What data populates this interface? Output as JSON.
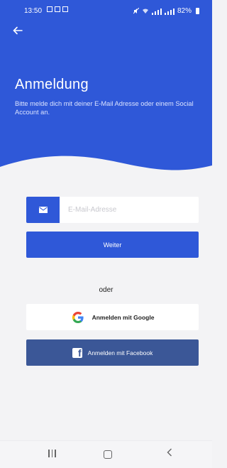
{
  "status_bar": {
    "time": "13:50",
    "battery": "82%",
    "left_icons": [
      "gallery-icon",
      "notification-icon",
      "notification-icon"
    ],
    "right_icons": [
      "mute-icon",
      "wifi-icon",
      "signal-icon",
      "signal-icon",
      "battery-icon"
    ]
  },
  "header": {
    "back_icon": "arrow-left-icon",
    "title": "Anmeldung",
    "subtitle": "Bitte melde dich mit deiner E-Mail Adresse oder einem Social Account an."
  },
  "email": {
    "icon": "mail-icon",
    "placeholder": "E-Mail-Adresse",
    "value": ""
  },
  "buttons": {
    "continue_label": "Weiter",
    "separator": "oder",
    "google_label": "Anmelden mit Google",
    "facebook_label": "Anmelden mit Facebook"
  },
  "navbar": {
    "recent_icon": "recent-apps-icon",
    "home_icon": "home-icon",
    "back_icon": "back-icon"
  },
  "colors": {
    "primary": "#2f58d8",
    "facebook": "#3b5797",
    "background": "#f3f3f5"
  }
}
